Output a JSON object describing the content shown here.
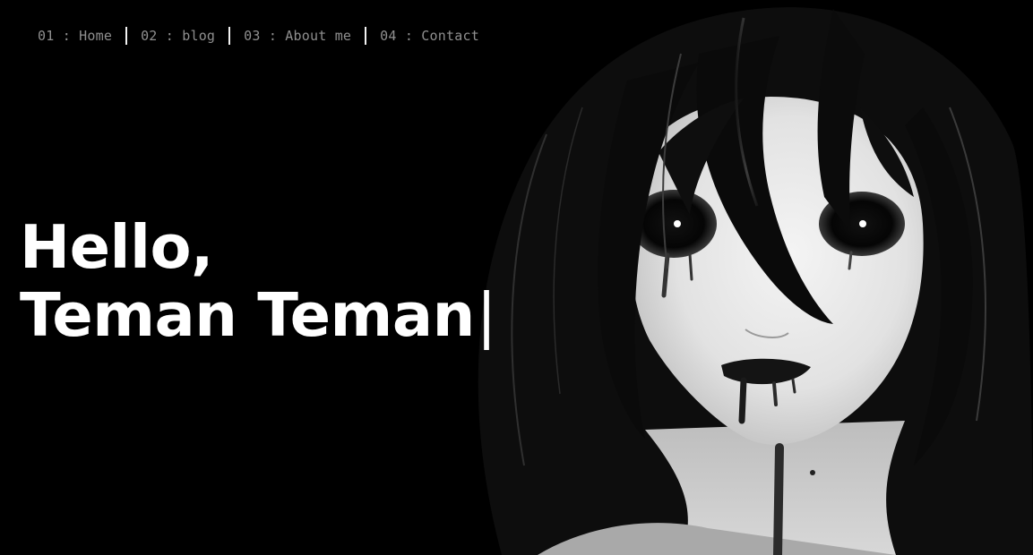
{
  "nav": {
    "items": [
      {
        "label": "01 : Home"
      },
      {
        "label": "02 : blog"
      },
      {
        "label": "03 : About me"
      },
      {
        "label": "04 : Contact"
      }
    ]
  },
  "hero": {
    "greeting": "Hello,",
    "typed_text": "Teman Teman",
    "caret": "|"
  },
  "colors": {
    "background": "#000000",
    "nav_text": "#8f8f8f",
    "nav_separator": "#f2f2f2",
    "headline": "#ffffff"
  },
  "illustration": {
    "subject": "monochrome anime girl with dark hollow eyes",
    "icon": "portrait-illustration"
  }
}
